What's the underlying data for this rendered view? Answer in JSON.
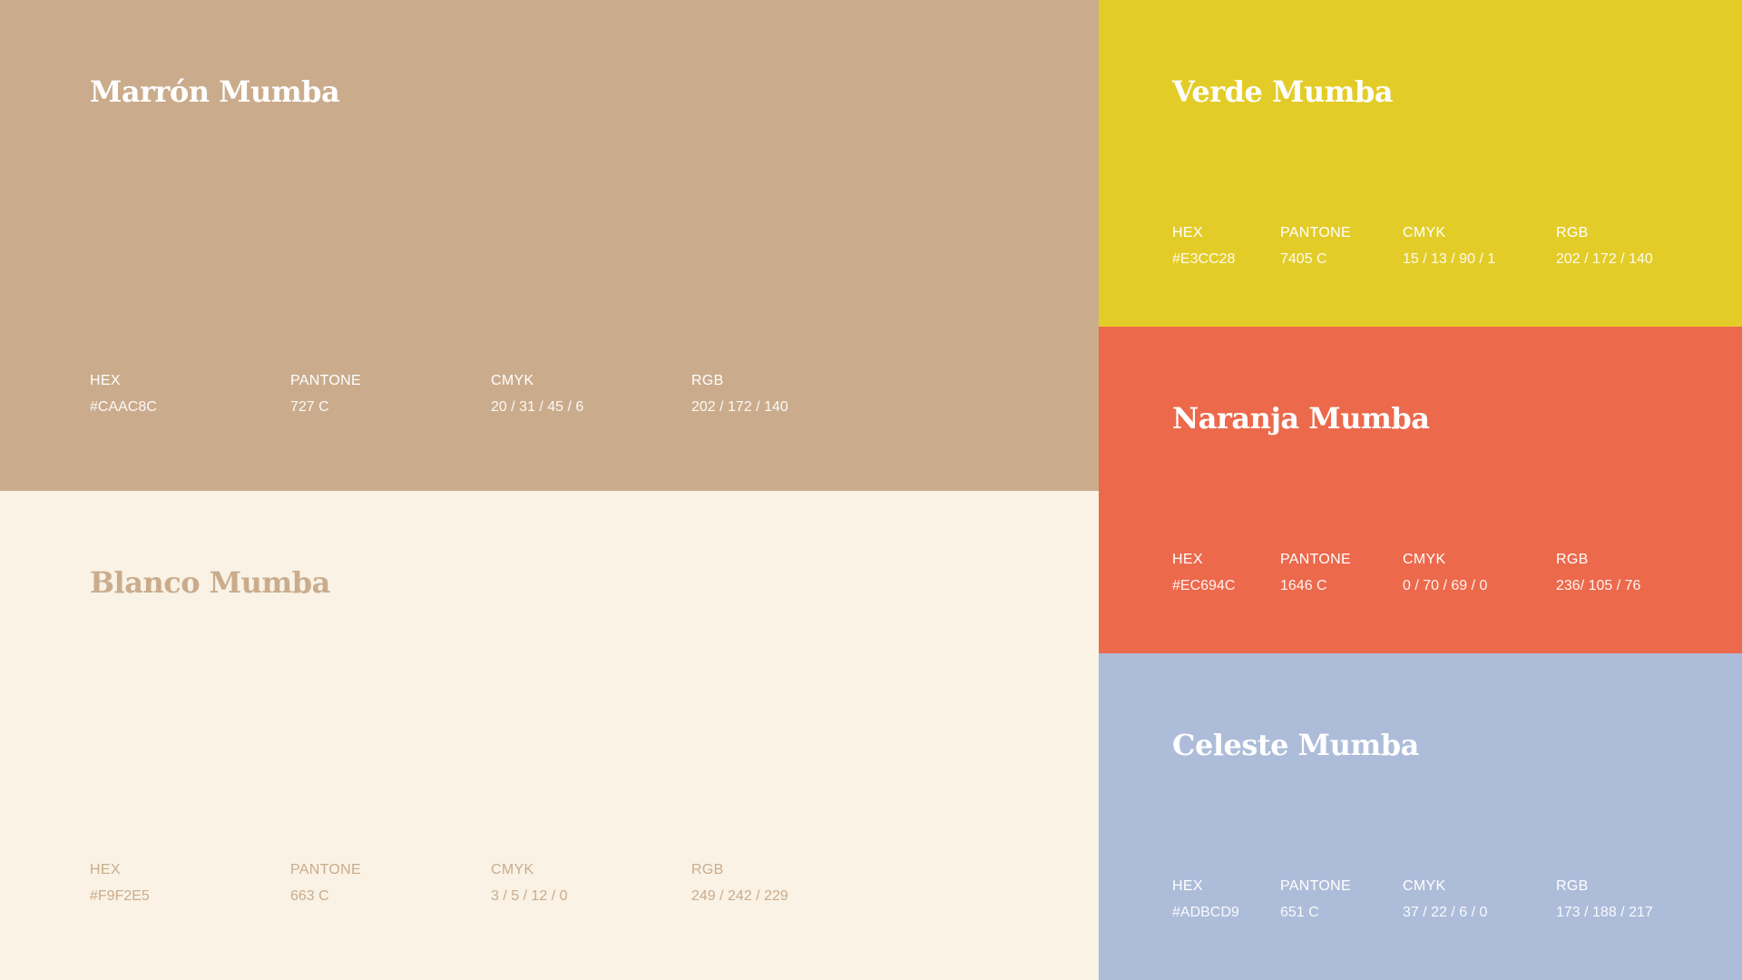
{
  "swatches": {
    "marron": {
      "name": "Marrón Mumba",
      "color": "#CAAC8C",
      "text_color": "#FFFFFF",
      "hex_label": "HEX",
      "hex": "#CAAC8C",
      "pantone_label": "PANTONE",
      "pantone": "727 C",
      "cmyk_label": "CMYK",
      "cmyk": "20 /  31  /  45  / 6",
      "rgb_label": "RGB",
      "rgb": "202 /  172  / 140"
    },
    "blanco": {
      "name": "Blanco Mumba",
      "color": "#F9F2E5",
      "text_color": "#CAAC8C",
      "hex_label": "HEX",
      "hex": "#F9F2E5",
      "pantone_label": "PANTONE",
      "pantone": "663 C",
      "cmyk_label": "CMYK",
      "cmyk": "3 /  5  / 12 / 0",
      "rgb_label": "RGB",
      "rgb": "249 /  242  / 229"
    },
    "verde": {
      "name": "Verde Mumba",
      "color": "#E3CC28",
      "text_color": "#FFFFFF",
      "hex_label": "HEX",
      "hex": "#E3CC28",
      "pantone_label": "PANTONE",
      "pantone": "7405 C",
      "cmyk_label": "CMYK",
      "cmyk": "15 /  13  / 90 / 1",
      "rgb_label": "RGB",
      "rgb": "202 /  172  / 140"
    },
    "naranja": {
      "name": "Naranja Mumba",
      "color": "#EC694C",
      "text_color": "#FFFFFF",
      "hex_label": "HEX",
      "hex": "#EC694C",
      "pantone_label": "PANTONE",
      "pantone": "1646 C",
      "cmyk_label": "CMYK",
      "cmyk": "0 /  70  / 69 / 0",
      "rgb_label": "RGB",
      "rgb": "236/  105  / 76"
    },
    "celeste": {
      "name": "Celeste Mumba",
      "color": "#ADBCD9",
      "text_color": "#FFFFFF",
      "hex_label": "HEX",
      "hex": "#ADBCD9",
      "pantone_label": "PANTONE",
      "pantone": "651 C",
      "cmyk_label": "CMYK",
      "cmyk": "37 /  22  / 6 / 0",
      "rgb_label": "RGB",
      "rgb": "173  /  188  / 217"
    }
  }
}
